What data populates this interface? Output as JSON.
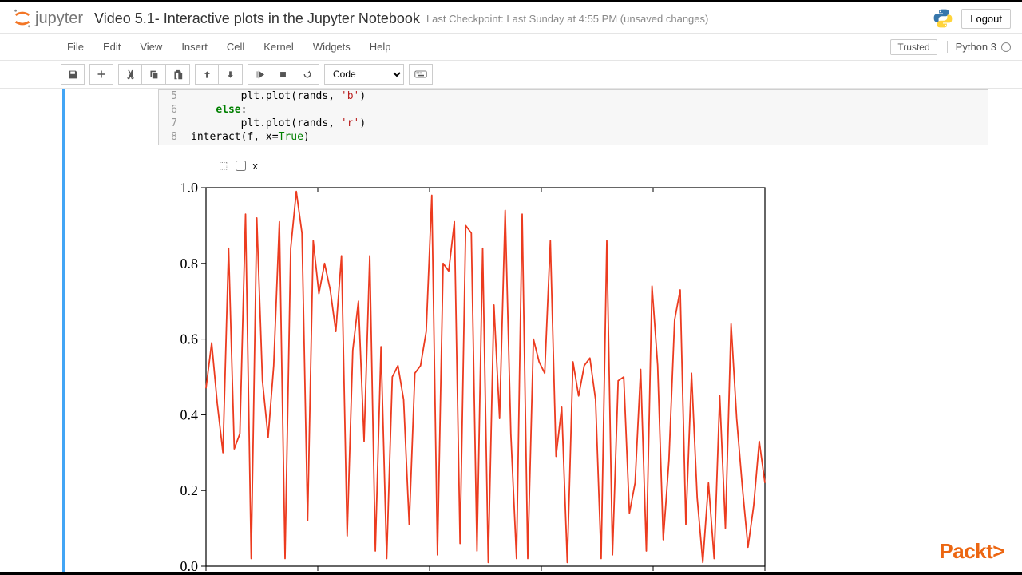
{
  "header": {
    "logo_text": "jupyter",
    "title": "Video 5.1- Interactive plots in the Jupyter Notebook",
    "checkpoint": "Last Checkpoint: Last Sunday at 4:55 PM (unsaved changes)",
    "logout": "Logout"
  },
  "menubar": {
    "items": [
      "File",
      "Edit",
      "View",
      "Insert",
      "Cell",
      "Kernel",
      "Widgets",
      "Help"
    ],
    "trusted": "Trusted",
    "kernel": "Python 3"
  },
  "toolbar": {
    "cell_type": "Code"
  },
  "code": {
    "lines": [
      {
        "num": "5",
        "indent": "        ",
        "parts": [
          [
            "plain",
            "plt.plot"
          ],
          [
            "paren",
            "("
          ],
          [
            "plain",
            "rands, "
          ],
          [
            "str",
            "'b'"
          ],
          [
            "paren",
            ")"
          ]
        ]
      },
      {
        "num": "6",
        "indent": "    ",
        "parts": [
          [
            "kw",
            "else"
          ],
          [
            "plain",
            ":"
          ]
        ]
      },
      {
        "num": "7",
        "indent": "        ",
        "parts": [
          [
            "plain",
            "plt.plot"
          ],
          [
            "paren",
            "("
          ],
          [
            "plain",
            "rands, "
          ],
          [
            "str",
            "'r'"
          ],
          [
            "paren",
            ")"
          ]
        ]
      },
      {
        "num": "8",
        "indent": "",
        "parts": [
          [
            "plain",
            "interact"
          ],
          [
            "paren",
            "("
          ],
          [
            "plain",
            "f, x="
          ],
          [
            "builtin",
            "True"
          ],
          [
            "paren",
            ")"
          ]
        ]
      }
    ]
  },
  "widget": {
    "label": "x",
    "checked": false
  },
  "chart_data": {
    "type": "line",
    "color": "#ec3b1f",
    "xlim": [
      0,
      100
    ],
    "ylim": [
      0.0,
      1.0
    ],
    "yticks": [
      0.0,
      0.2,
      0.4,
      0.6,
      0.8,
      1.0
    ],
    "values": [
      0.47,
      0.59,
      0.43,
      0.3,
      0.84,
      0.31,
      0.35,
      0.93,
      0.02,
      0.92,
      0.49,
      0.34,
      0.53,
      0.91,
      0.02,
      0.84,
      0.99,
      0.88,
      0.12,
      0.86,
      0.72,
      0.8,
      0.73,
      0.62,
      0.82,
      0.08,
      0.57,
      0.7,
      0.33,
      0.82,
      0.04,
      0.58,
      0.02,
      0.5,
      0.53,
      0.44,
      0.11,
      0.51,
      0.53,
      0.62,
      0.98,
      0.03,
      0.8,
      0.78,
      0.91,
      0.06,
      0.9,
      0.88,
      0.04,
      0.84,
      0.01,
      0.69,
      0.39,
      0.94,
      0.35,
      0.02,
      0.93,
      0.02,
      0.6,
      0.54,
      0.51,
      0.86,
      0.29,
      0.42,
      0.01,
      0.54,
      0.45,
      0.53,
      0.55,
      0.44,
      0.02,
      0.86,
      0.03,
      0.49,
      0.5,
      0.14,
      0.22,
      0.52,
      0.04,
      0.74,
      0.53,
      0.07,
      0.28,
      0.65,
      0.73,
      0.11,
      0.51,
      0.18,
      0.01,
      0.22,
      0.02,
      0.45,
      0.1,
      0.64,
      0.39,
      0.21,
      0.05,
      0.16,
      0.33,
      0.22
    ]
  },
  "brand": "Packt>"
}
